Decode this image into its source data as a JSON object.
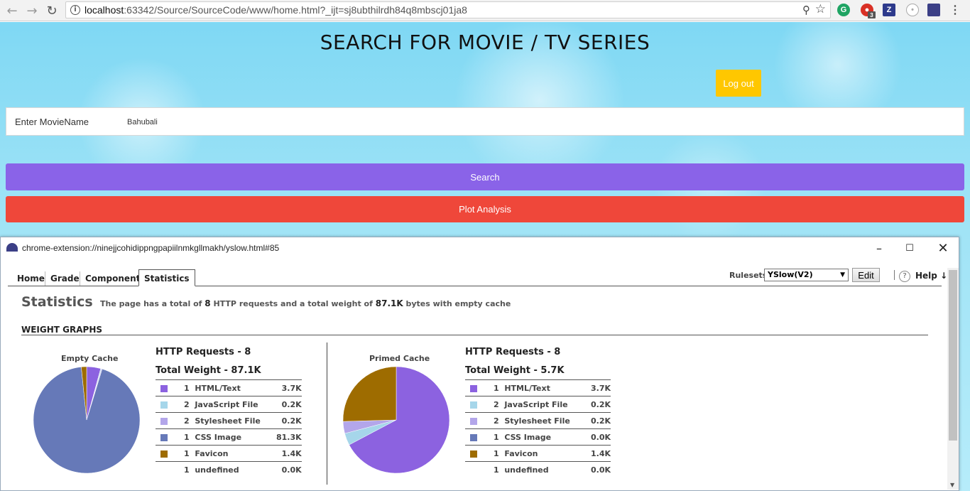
{
  "browser": {
    "url_host": "localhost",
    "url_rest": ":63342/Source/SourceCode/www/home.html?_ijt=sj8ubthilrdh84q8mbscj01ja8",
    "ext_badge": "3"
  },
  "page": {
    "title": "SEARCH FOR MOVIE / TV SERIES",
    "logout_label": "Log out",
    "search_label": "Enter MovieName",
    "search_value": "Bahubali",
    "search_button": "Search",
    "plot_button": "Plot Analysis"
  },
  "yslow": {
    "window_title": "chrome-extension://ninejjcohidippngpapiilnmkgllmakh/yslow.html#85",
    "tabs": [
      "Home",
      "Grade",
      "Components",
      "Statistics"
    ],
    "rulesets_label": "Rulesets",
    "ruleset_value": "YSlow(V2)",
    "edit_label": "Edit",
    "help_label": "Help",
    "stat_heading": "Statistics",
    "desc_pre": "The page has a total of",
    "desc_requests": "8",
    "desc_mid": "HTTP requests and a total weight of",
    "desc_weight": "87.1K",
    "desc_post": "bytes with empty cache",
    "weight_heading": "WEIGHT GRAPHS",
    "empty": {
      "label": "Empty Cache",
      "requests": "HTTP Requests - 8",
      "weight": "Total Weight - 87.1K",
      "rows": [
        {
          "count": "1",
          "type": "HTML/Text",
          "size": "3.7K",
          "color": "#8c62e0"
        },
        {
          "count": "2",
          "type": "JavaScript File",
          "size": "0.2K",
          "color": "#a6d6ea"
        },
        {
          "count": "2",
          "type": "Stylesheet File",
          "size": "0.2K",
          "color": "#b3a6ea"
        },
        {
          "count": "1",
          "type": "CSS Image",
          "size": "81.3K",
          "color": "#6679b8"
        },
        {
          "count": "1",
          "type": "Favicon",
          "size": "1.4K",
          "color": "#9e6c00"
        },
        {
          "count": "1",
          "type": "undefined",
          "size": "0.0K",
          "color": ""
        }
      ]
    },
    "primed": {
      "label": "Primed Cache",
      "requests": "HTTP Requests - 8",
      "weight": "Total Weight - 5.7K",
      "rows": [
        {
          "count": "1",
          "type": "HTML/Text",
          "size": "3.7K",
          "color": "#8c62e0"
        },
        {
          "count": "2",
          "type": "JavaScript File",
          "size": "0.2K",
          "color": "#a6d6ea"
        },
        {
          "count": "2",
          "type": "Stylesheet File",
          "size": "0.2K",
          "color": "#b3a6ea"
        },
        {
          "count": "1",
          "type": "CSS Image",
          "size": "0.0K",
          "color": "#6679b8"
        },
        {
          "count": "1",
          "type": "Favicon",
          "size": "1.4K",
          "color": "#9e6c00"
        },
        {
          "count": "1",
          "type": "undefined",
          "size": "0.0K",
          "color": ""
        }
      ]
    }
  },
  "chart_data": [
    {
      "type": "pie",
      "title": "Empty Cache",
      "categories": [
        "HTML/Text",
        "JavaScript File",
        "Stylesheet File",
        "CSS Image",
        "Favicon",
        "undefined"
      ],
      "values": [
        3.7,
        0.2,
        0.2,
        81.3,
        1.4,
        0.0
      ]
    },
    {
      "type": "pie",
      "title": "Primed Cache",
      "categories": [
        "HTML/Text",
        "JavaScript File",
        "Stylesheet File",
        "CSS Image",
        "Favicon",
        "undefined"
      ],
      "values": [
        3.7,
        0.2,
        0.2,
        0.0,
        1.4,
        0.0
      ]
    }
  ]
}
